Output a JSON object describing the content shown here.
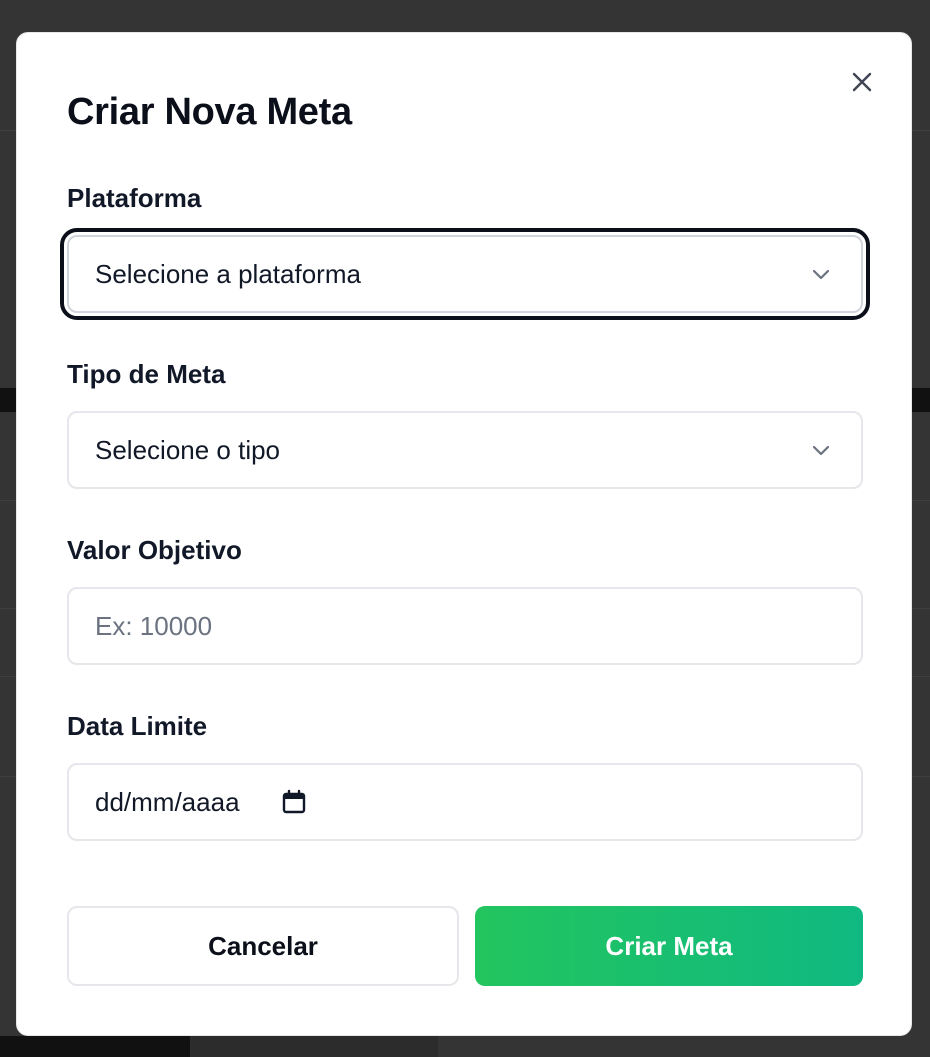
{
  "modal": {
    "title": "Criar Nova Meta",
    "close_icon": "close-icon"
  },
  "fields": {
    "platform": {
      "label": "Plataforma",
      "selected": "Selecione a plataforma"
    },
    "goal_type": {
      "label": "Tipo de Meta",
      "selected": "Selecione o tipo"
    },
    "target_value": {
      "label": "Valor Objetivo",
      "placeholder": "Ex: 10000"
    },
    "deadline": {
      "label": "Data Limite",
      "placeholder": "dd/mm/aaaa",
      "icon": "calendar-icon"
    }
  },
  "actions": {
    "cancel_label": "Cancelar",
    "create_label": "Criar Meta"
  },
  "colors": {
    "primary_gradient_start": "#22c55e",
    "primary_gradient_end": "#10b981",
    "backdrop": "#343434"
  }
}
